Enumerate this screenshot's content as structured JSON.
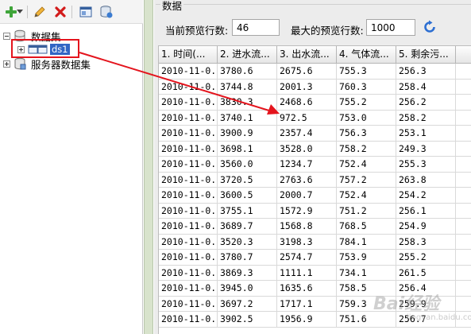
{
  "toolbar": {
    "items": [
      {
        "icon": "add-icon"
      },
      {
        "icon": "dropdown-arrow-icon"
      },
      {
        "icon": "edit-icon"
      },
      {
        "icon": "delete-icon"
      },
      {
        "icon": "dataset-properties-icon"
      },
      {
        "icon": "database-refresh-icon"
      }
    ]
  },
  "tree": {
    "root_label": "数据集",
    "child_label": "ds1",
    "server_label": "服务器数据集"
  },
  "panel": {
    "title": "数据",
    "preview_rows_label": "当前预览行数:",
    "preview_rows_value": "46",
    "max_rows_label": "最大的预览行数:",
    "max_rows_value": "1000"
  },
  "table": {
    "columns": [
      "1. 时间(...",
      "2. 进水流...",
      "3. 出水流...",
      "4. 气体流...",
      "5. 剩余污..."
    ],
    "rows": [
      [
        "2010-11-0...",
        "3780.6",
        "2675.6",
        "755.3",
        "256.3"
      ],
      [
        "2010-11-0...",
        "3744.8",
        "2001.3",
        "760.3",
        "258.4"
      ],
      [
        "2010-11-0...",
        "3830.3",
        "2468.6",
        "755.2",
        "256.2"
      ],
      [
        "2010-11-0...",
        "3740.1",
        "972.5",
        "753.0",
        "258.2"
      ],
      [
        "2010-11-0...",
        "3900.9",
        "2357.4",
        "756.3",
        "253.1"
      ],
      [
        "2010-11-0...",
        "3698.1",
        "3528.0",
        "758.2",
        "249.3"
      ],
      [
        "2010-11-0...",
        "3560.0",
        "1234.7",
        "752.4",
        "255.3"
      ],
      [
        "2010-11-0...",
        "3720.5",
        "2763.6",
        "757.2",
        "263.8"
      ],
      [
        "2010-11-0...",
        "3600.5",
        "2000.7",
        "752.4",
        "254.2"
      ],
      [
        "2010-11-0...",
        "3755.1",
        "1572.9",
        "751.2",
        "256.1"
      ],
      [
        "2010-11-0...",
        "3689.7",
        "1568.8",
        "768.5",
        "254.9"
      ],
      [
        "2010-11-0...",
        "3520.3",
        "3198.3",
        "784.1",
        "258.3"
      ],
      [
        "2010-11-0...",
        "3780.7",
        "2574.7",
        "753.9",
        "255.2"
      ],
      [
        "2010-11-0...",
        "3869.3",
        "1111.1",
        "734.1",
        "261.5"
      ],
      [
        "2010-11-0...",
        "3945.0",
        "1635.6",
        "758.5",
        "256.4"
      ],
      [
        "2010-11-0...",
        "3697.2",
        "1717.1",
        "759.3",
        "259.9"
      ],
      [
        "2010-11-0...",
        "3902.5",
        "1956.9",
        "751.6",
        "256.7"
      ]
    ]
  },
  "watermark": {
    "main": "Bai经验",
    "sub": "jingyan.baidu.com"
  },
  "colors": {
    "highlight": "#e4141d",
    "selection": "#3166c5"
  }
}
